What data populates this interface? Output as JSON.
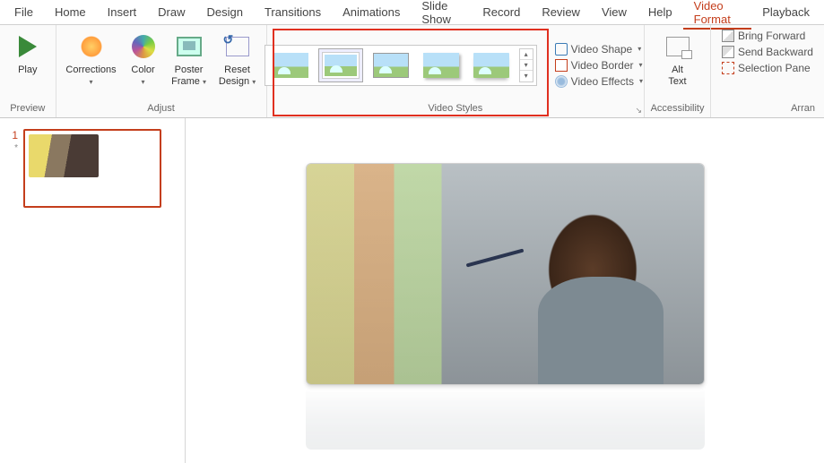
{
  "menu": {
    "items": [
      "File",
      "Home",
      "Insert",
      "Draw",
      "Design",
      "Transitions",
      "Animations",
      "Slide Show",
      "Record",
      "Review",
      "View",
      "Help",
      "Video Format",
      "Playback"
    ],
    "active": "Video Format"
  },
  "ribbon": {
    "preview": {
      "play": "Play",
      "label": "Preview"
    },
    "adjust": {
      "corrections": "Corrections",
      "color": "Color",
      "poster_frame_l1": "Poster",
      "poster_frame_l2": "Frame",
      "reset_l1": "Reset",
      "reset_l2": "Design",
      "label": "Adjust"
    },
    "video_styles": {
      "label": "Video Styles"
    },
    "shape_menu": {
      "shape": "Video Shape",
      "border": "Video Border",
      "effects": "Video Effects"
    },
    "accessibility": {
      "alt_l1": "Alt",
      "alt_l2": "Text",
      "label": "Accessibility"
    },
    "arrange": {
      "bring_forward": "Bring Forward",
      "send_backward": "Send Backward",
      "selection_pane": "Selection Pane",
      "label": "Arran"
    }
  },
  "thumb": {
    "num": "1",
    "star": "*"
  }
}
